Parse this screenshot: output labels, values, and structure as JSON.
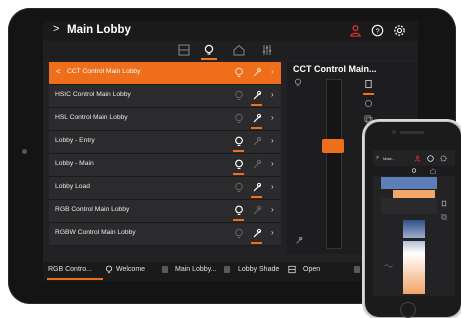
{
  "tablet": {
    "header": {
      "back_glyph": ">",
      "title": "Main Lobby"
    },
    "list": [
      {
        "label": "CCT Control Main Lobby",
        "active": true
      },
      {
        "label": "HSIC Control Main Lobby",
        "active": false
      },
      {
        "label": "HSL Control Main Lobby",
        "active": false
      },
      {
        "label": "Lobby - Entry",
        "active": false
      },
      {
        "label": "Lobby - Main",
        "active": false
      },
      {
        "label": "Lobby Load",
        "active": false
      },
      {
        "label": "RGB Control Main Lobby",
        "active": false
      },
      {
        "label": "RGBW Control Main Lobby",
        "active": false
      }
    ],
    "right_panel": {
      "title": "CCT Control Main..."
    },
    "bottom_bar": {
      "item1": "RGB Contro...",
      "item2": "Welcome",
      "item3": "Main Lobby...",
      "item4": "Lobby Shade",
      "item5": "Open"
    },
    "colors": {
      "accent": "#ee6e1c",
      "alert": "#e0322b",
      "background": "#222224"
    }
  },
  "phone": {
    "header": {
      "back_glyph": ">",
      "title": "Mast..."
    }
  },
  "icons": [
    "chevron-right-icon",
    "user-alert-icon",
    "help-icon",
    "gear-icon",
    "room-icon",
    "lightbulb-icon",
    "home-icon",
    "sliders-icon",
    "lock-icon",
    "chevron-left-icon",
    "window-icon"
  ]
}
